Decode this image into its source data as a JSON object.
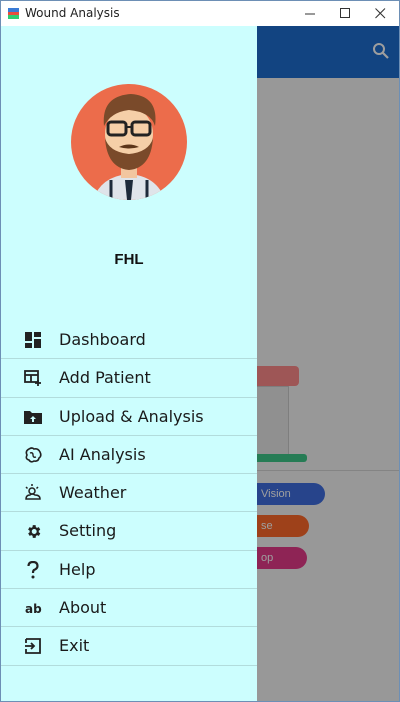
{
  "window": {
    "title": "Wound Analysis",
    "minimize_glyph": "—",
    "maximize_glyph": "□",
    "close_glyph": "✕"
  },
  "background": {
    "chips": [
      "Vision",
      "se",
      "op"
    ]
  },
  "drawer": {
    "user_name": "FHL",
    "items": [
      {
        "label": "Dashboard",
        "icon": "dashboard-icon"
      },
      {
        "label": "Add Patient",
        "icon": "add-table-icon"
      },
      {
        "label": "Upload & Analysis",
        "icon": "upload-folder-icon"
      },
      {
        "label": "AI Analysis",
        "icon": "brain-icon"
      },
      {
        "label": "Weather",
        "icon": "weather-icon"
      },
      {
        "label": "Setting",
        "icon": "gear-icon"
      },
      {
        "label": "Help",
        "icon": "question-icon"
      },
      {
        "label": "About",
        "icon": "ab-text-icon"
      },
      {
        "label": "Exit",
        "icon": "exit-icon"
      }
    ]
  },
  "colors": {
    "appbar": "#1e6fd0",
    "drawer_bg": "#ccfefe",
    "avatar_bg": "#ec6c4b"
  }
}
